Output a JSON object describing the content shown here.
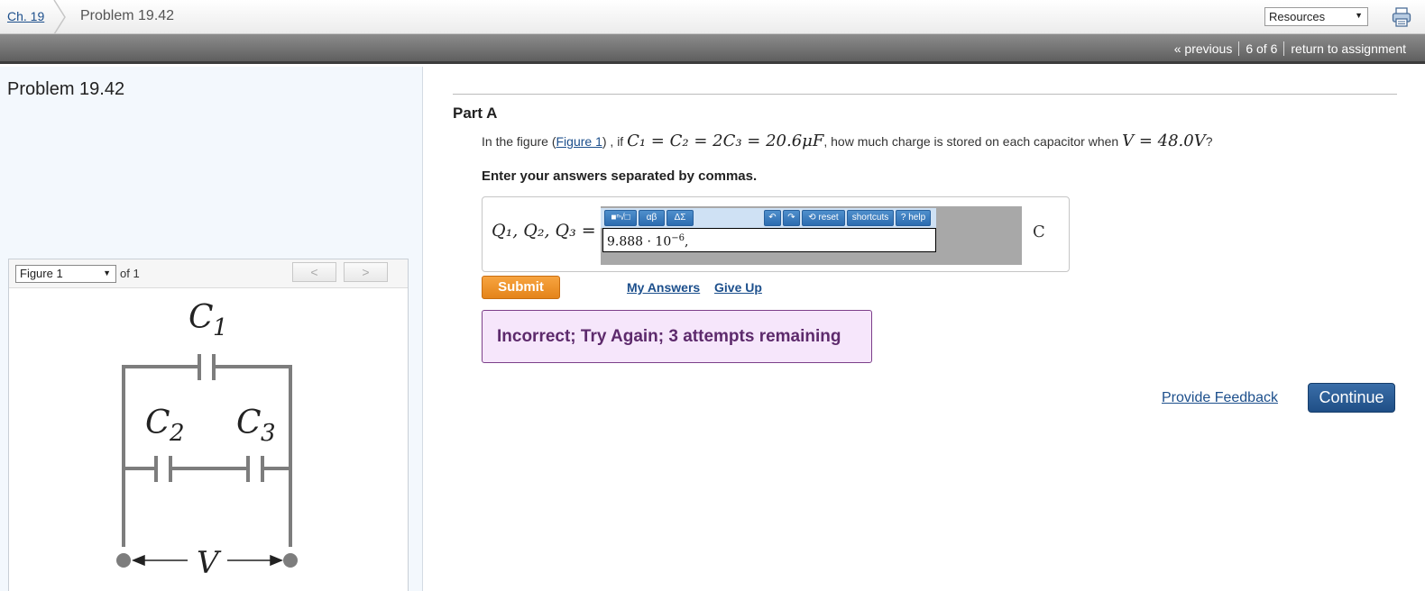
{
  "header": {
    "chapter_link": "Ch. 19",
    "title": "Problem 19.42",
    "resources_select": "Resources"
  },
  "nav": {
    "previous": "« previous",
    "position": "6 of 6",
    "return": "return to assignment"
  },
  "left": {
    "title": "Problem 19.42",
    "figure_select": "Figure 1",
    "figure_of": "of 1",
    "prev_btn": "<",
    "next_btn": ">",
    "circuit_labels": {
      "c1": "C",
      "c1_sub": "1",
      "c2": "C",
      "c2_sub": "2",
      "c3": "C",
      "c3_sub": "3",
      "v": "V"
    }
  },
  "part": {
    "title": "Part A",
    "question_prefix": "In the figure (",
    "question_link": "Figure 1",
    "question_mid": ") , if ",
    "question_math1": "C₁ = C₂ = 2C₃ = 20.6μF",
    "question_mid2": ", how much charge is stored on each capacitor when ",
    "question_math2": "V = 48.0V",
    "question_end": "?",
    "instruction": "Enter your answers separated by commas."
  },
  "answer": {
    "label": "Q₁, Q₂, Q₃ =",
    "input_base": "9.888 · 10",
    "input_exp": "−6",
    "input_tail": ",",
    "unit": "C",
    "toolbar": {
      "templates": "■ⁿ√□",
      "greek": "αβ",
      "symbols": "ΔΣ",
      "reset": "reset",
      "shortcuts": "shortcuts",
      "help": "help",
      "undo_icon": "undo-icon",
      "redo_icon": "redo-icon"
    }
  },
  "actions": {
    "submit": "Submit",
    "my_answers": "My Answers",
    "give_up": "Give Up",
    "feedback_message": "Incorrect; Try Again; 3 attempts remaining",
    "provide_feedback": "Provide Feedback",
    "continue": "Continue"
  },
  "colors": {
    "link": "#1c4f8c",
    "submit": "#ef9425",
    "error_bg": "#f6e6fb",
    "error_text": "#5d2a6c",
    "continue": "#2a5c96"
  }
}
